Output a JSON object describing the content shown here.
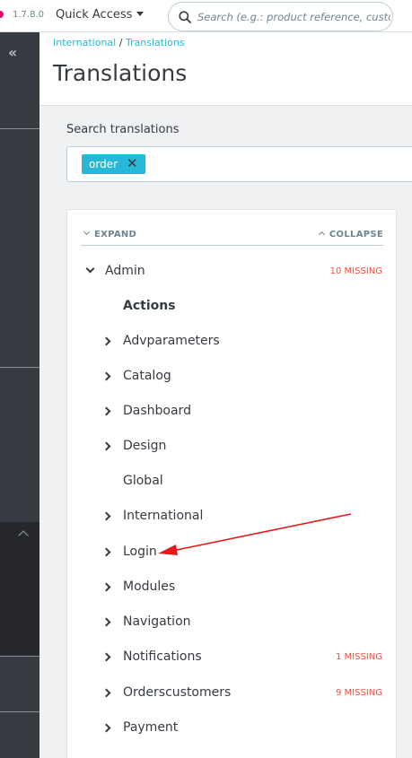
{
  "header": {
    "version": "1.7.8.0",
    "quick_access": "Quick Access",
    "search_placeholder": "Search (e.g.: product reference, custon",
    "brand_color": "#df0067"
  },
  "sidebar": {
    "collapse_icon": "double-chevron-left-icon"
  },
  "breadcrumb": {
    "items": [
      "International",
      "Translations"
    ],
    "separator": "/"
  },
  "page_title": "Translations",
  "search": {
    "label": "Search translations",
    "tags": [
      {
        "text": "order",
        "remove": "✕"
      }
    ],
    "tag_color": "#25b9d7"
  },
  "tree": {
    "expand_label": "EXPAND",
    "collapse_label": "COLLAPSE",
    "missing_color": "#f54c3e",
    "items": [
      {
        "label": "Admin",
        "missing": "10 MISSING",
        "arrow": "down",
        "level": 0
      },
      {
        "label": "Actions",
        "missing": "",
        "arrow": "none",
        "level": 1,
        "bold": true
      },
      {
        "label": "Advparameters",
        "missing": "",
        "arrow": "right",
        "level": 1
      },
      {
        "label": "Catalog",
        "missing": "",
        "arrow": "right",
        "level": 1
      },
      {
        "label": "Dashboard",
        "missing": "",
        "arrow": "right",
        "level": 1
      },
      {
        "label": "Design",
        "missing": "",
        "arrow": "right",
        "level": 1
      },
      {
        "label": "Global",
        "missing": "",
        "arrow": "none",
        "level": 1
      },
      {
        "label": "International",
        "missing": "",
        "arrow": "right",
        "level": 1
      },
      {
        "label": "Login",
        "missing": "",
        "arrow": "right",
        "level": 1
      },
      {
        "label": "Modules",
        "missing": "",
        "arrow": "right",
        "level": 1
      },
      {
        "label": "Navigation",
        "missing": "",
        "arrow": "right",
        "level": 1
      },
      {
        "label": "Notifications",
        "missing": "1 MISSING",
        "arrow": "right",
        "level": 1
      },
      {
        "label": "Orderscustomers",
        "missing": "9 MISSING",
        "arrow": "right",
        "level": 1
      },
      {
        "label": "Payment",
        "missing": "",
        "arrow": "right",
        "level": 1
      }
    ]
  },
  "annotation": {
    "color": "#e8191b"
  }
}
